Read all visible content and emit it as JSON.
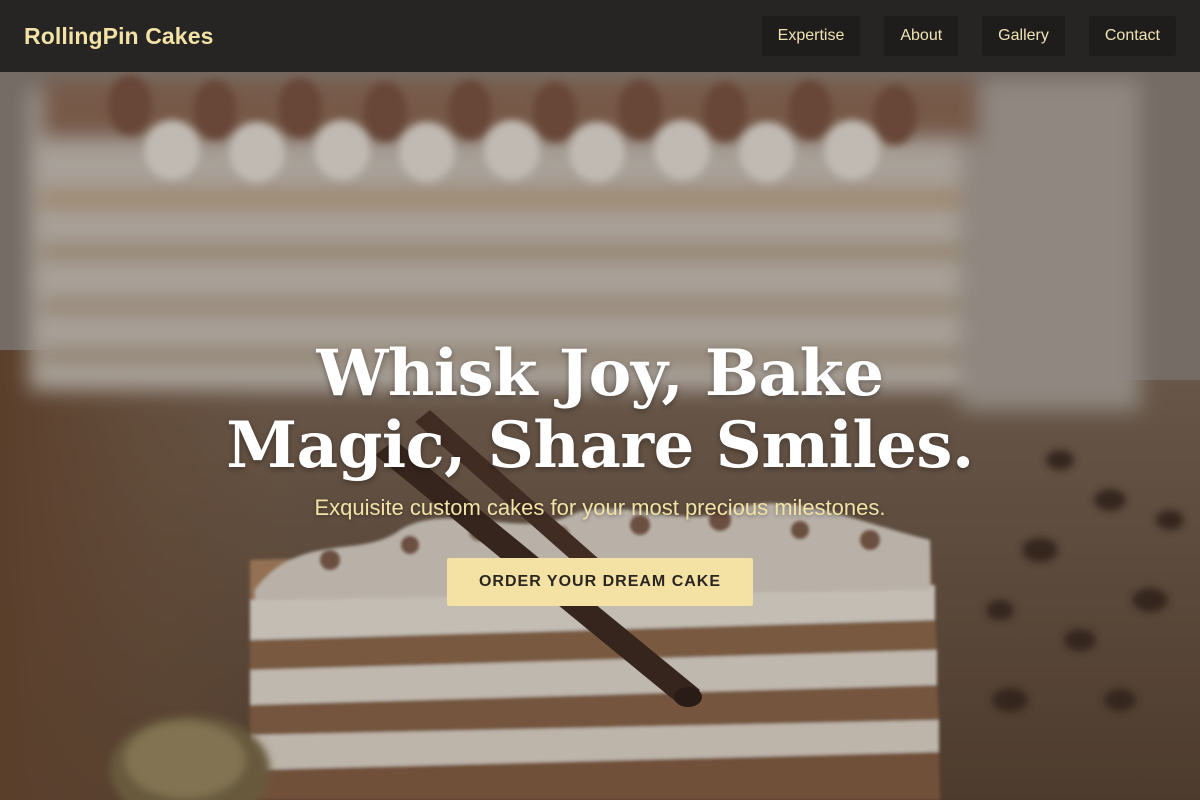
{
  "header": {
    "brand": "RollingPin Cakes",
    "nav": [
      {
        "label": "Expertise"
      },
      {
        "label": "About"
      },
      {
        "label": "Gallery"
      },
      {
        "label": "Contact"
      }
    ]
  },
  "hero": {
    "title": "Whisk Joy, Bake Magic, Share Smiles.",
    "subtitle": "Exquisite custom cakes for your most precious milestones.",
    "cta_label": "ORDER YOUR DREAM CAKE",
    "background": "cake-photo"
  },
  "colors": {
    "nav_bg": "#262524",
    "nav_button_bg": "#1e1d1c",
    "accent": "#f2e2a6",
    "cta_bg": "#f4e2a4",
    "title": "#ffffff"
  }
}
